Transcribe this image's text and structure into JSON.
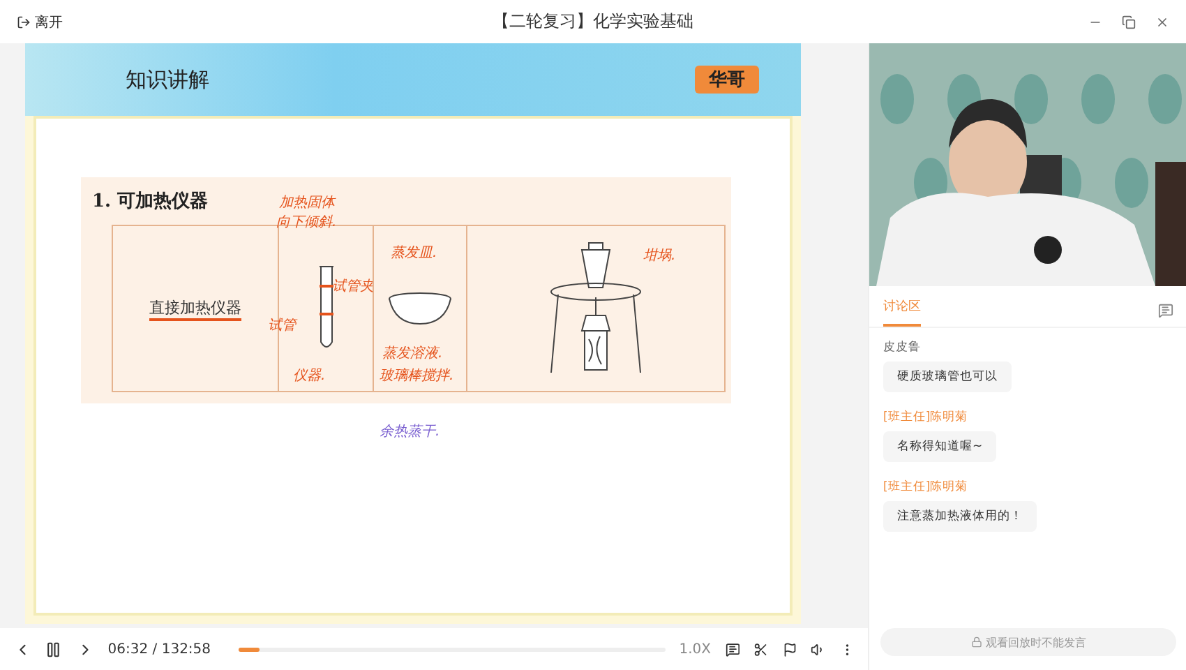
{
  "window": {
    "back_label": "离开",
    "title": "【二轮复习】化学实验基础"
  },
  "slide": {
    "header": "知识讲解",
    "badge": "华哥",
    "heading": "1. 可加热仪器",
    "row_label": "直接加热仪器",
    "notes_tube": [
      {
        "text": "加热固体",
        "color": "#e5531c"
      },
      {
        "text": "向下倾斜.",
        "color": "#e5531c"
      },
      {
        "text": "试管夹",
        "color": "#e5531c"
      },
      {
        "text": "试管",
        "color": "#e5531c"
      },
      {
        "text": "仪器.",
        "color": "#e5531c"
      }
    ],
    "notes_dish": [
      {
        "text": "蒸发皿.",
        "color": "#e5531c"
      },
      {
        "text": "蒸发溶液.",
        "color": "#e5531c"
      },
      {
        "text": "玻璃棒搅拌.",
        "color": "#e5531c"
      },
      {
        "text": "余热蒸干.",
        "color": "#7a5fd0"
      }
    ],
    "notes_crucible": [
      {
        "text": "坩埚.",
        "color": "#e5531c"
      }
    ]
  },
  "player": {
    "time": "06:32",
    "separator": "/",
    "duration": "132:58",
    "level": 0.049,
    "speed": "1.0X"
  },
  "chat": {
    "tabs": [
      {
        "label": "讨论区",
        "selected": true
      }
    ],
    "messages": [
      {
        "author": "皮皮鲁",
        "kind": "student",
        "text": "硬质玻璃管也可以"
      },
      {
        "author": "[班主任]陈明菊",
        "kind": "teacher",
        "text": "名称得知道喔~"
      },
      {
        "author": "[班主任]陈明菊",
        "kind": "teacher",
        "text": "注意蒸加热液体用的！"
      }
    ],
    "input_placeholder": "观看回放时不能发言"
  }
}
